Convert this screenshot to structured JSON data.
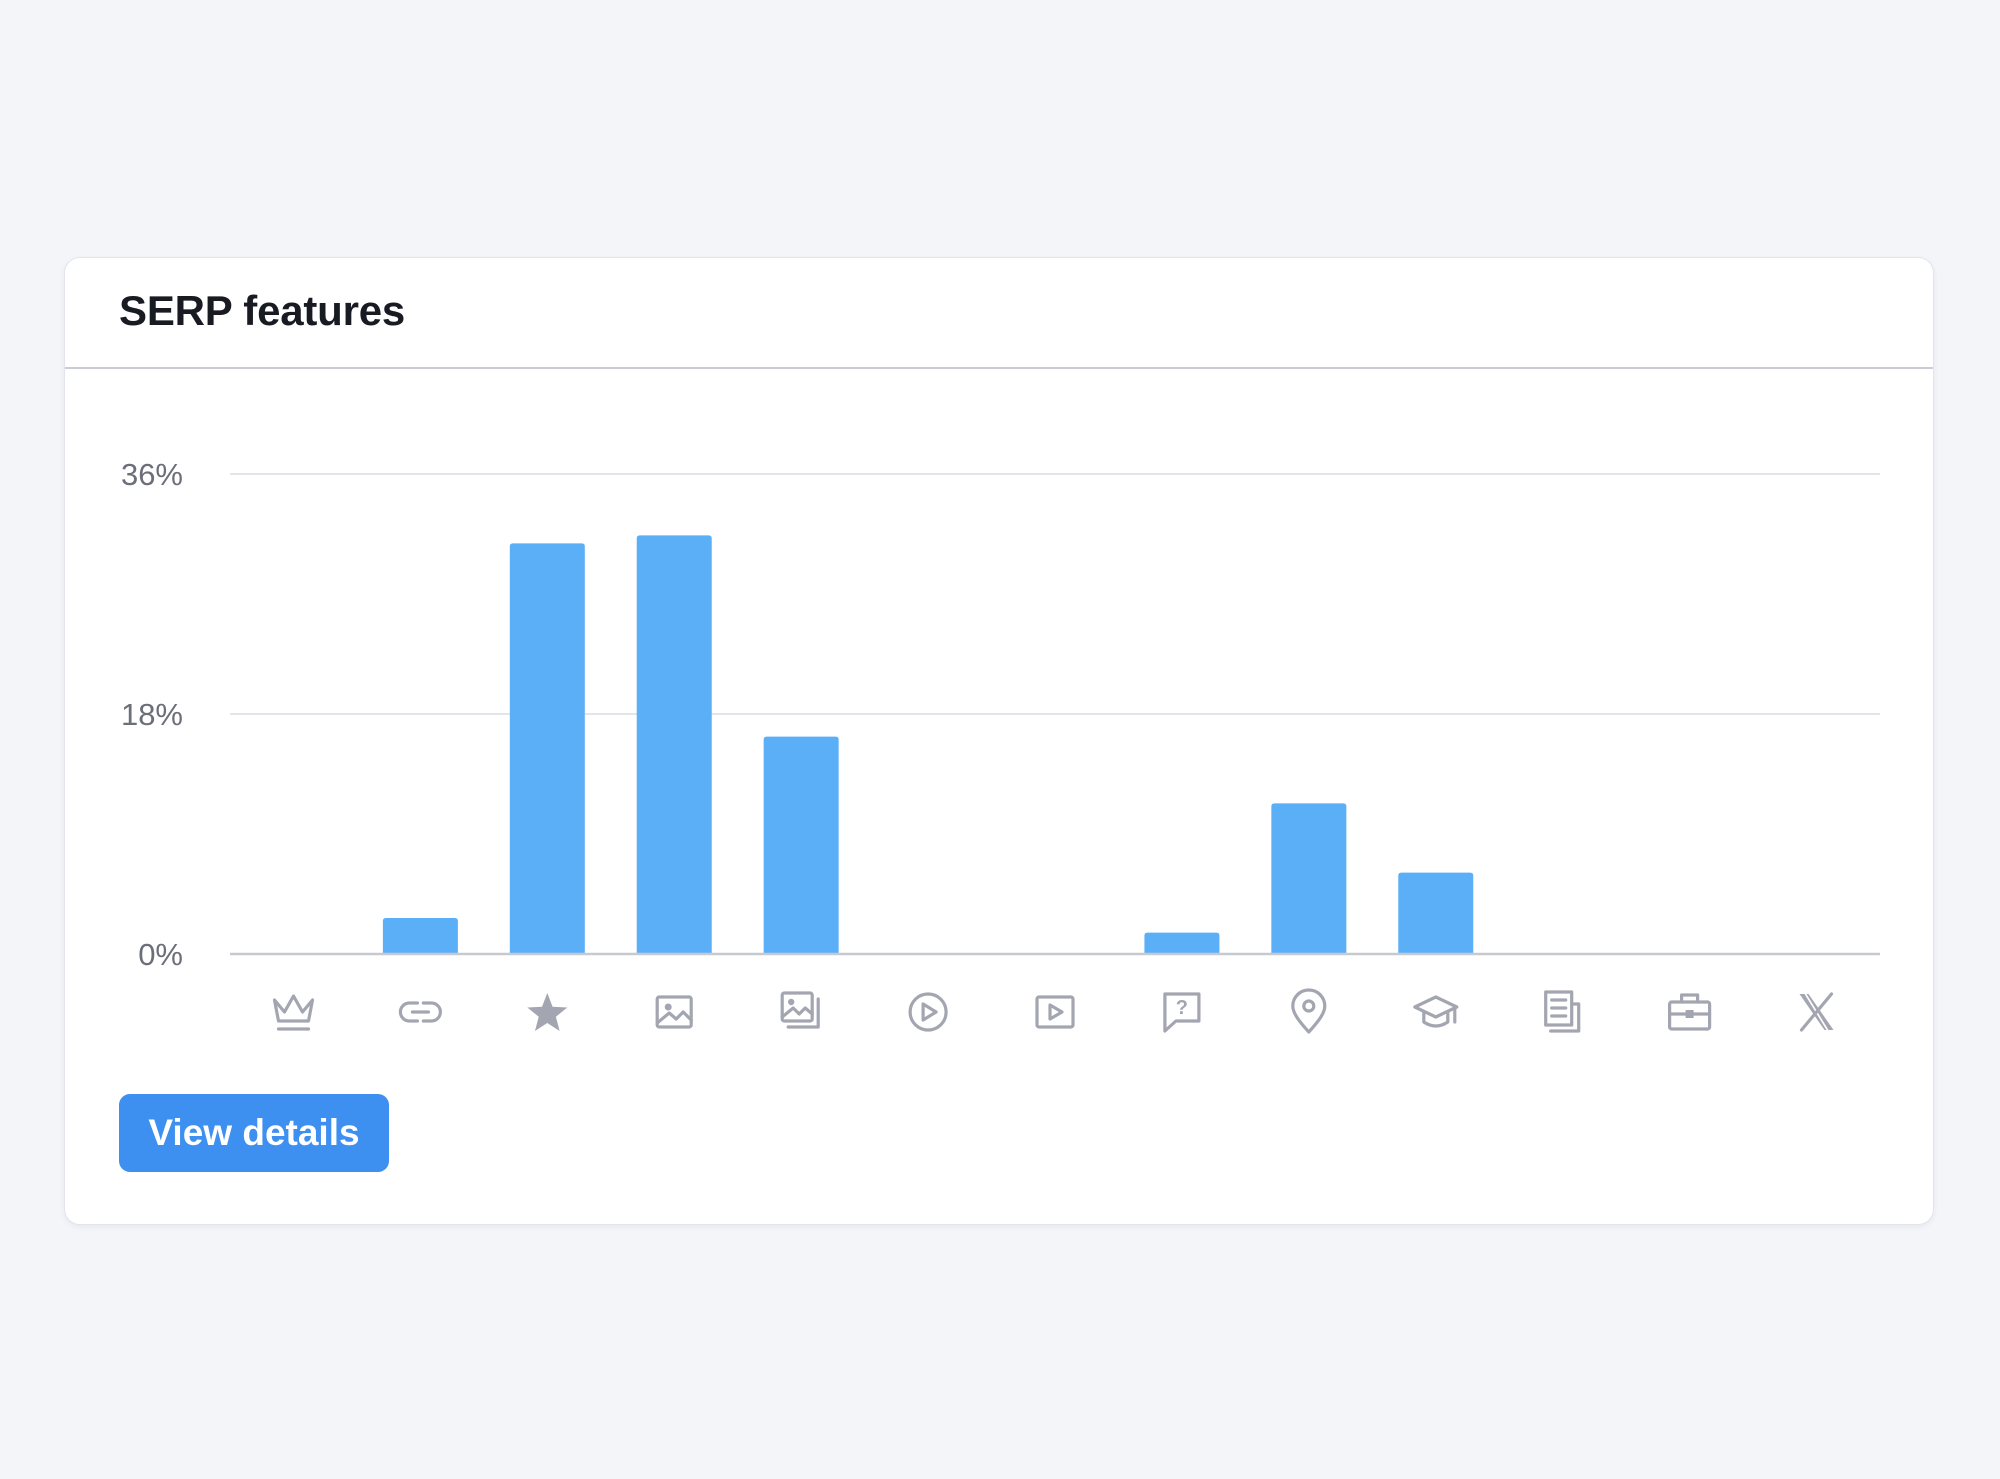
{
  "card": {
    "title": "SERP features",
    "view_details_label": "View details"
  },
  "colors": {
    "bar": "#5aaff7",
    "button": "#3d8ff0",
    "grid": "#e3e5ea",
    "axis": "#c7c9d1",
    "icon": "#a3a6b1",
    "tick_text": "#6c6f7a"
  },
  "chart_data": {
    "type": "bar",
    "title": "",
    "xlabel": "",
    "ylabel": "",
    "ylim": [
      0,
      36
    ],
    "yticks": [
      "0%",
      "18%",
      "36%"
    ],
    "ytick_values": [
      0,
      18,
      36
    ],
    "grid": true,
    "categories": [
      "featured-snippet-icon",
      "sitelinks-icon",
      "reviews-icon",
      "image-icon",
      "image-pack-icon",
      "video-icon",
      "featured-video-icon",
      "people-also-ask-icon",
      "local-pack-icon",
      "knowledge-panel-icon",
      "top-stories-icon",
      "jobs-icon",
      "twitter-x-icon"
    ],
    "values": [
      0,
      2.7,
      30.8,
      31.4,
      16.3,
      0,
      0,
      1.6,
      11.3,
      6.1,
      0,
      0,
      0
    ]
  }
}
